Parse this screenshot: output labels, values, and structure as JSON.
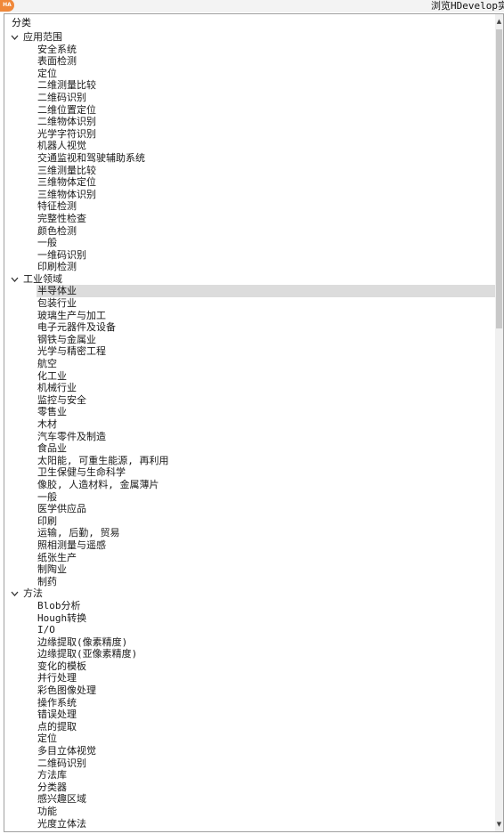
{
  "window": {
    "title": "浏览HDevelop实",
    "icon_text": "HA"
  },
  "tree": {
    "header": "分类",
    "groups": [
      {
        "label": "应用范围",
        "items": [
          "安全系统",
          "表面检测",
          "定位",
          "二维测量比较",
          "二维码识别",
          "二维位置定位",
          "二维物体识别",
          "光学字符识别",
          "机器人视觉",
          "交通监视和驾驶辅助系统",
          "三维测量比较",
          "三维物体定位",
          "三维物体识别",
          "特征检测",
          "完整性检查",
          "颜色检测",
          "一般",
          "一维码识别",
          "印刷检测"
        ]
      },
      {
        "label": "工业领域",
        "items": [
          "半导体业",
          "包装行业",
          "玻璃生产与加工",
          "电子元器件及设备",
          "钢铁与金属业",
          "光学与精密工程",
          "航空",
          "化工业",
          "机械行业",
          "监控与安全",
          "零售业",
          "木材",
          "汽车零件及制造",
          "食品业",
          "太阳能, 可重生能源, 再利用",
          "卫生保健与生命科学",
          "像胶, 人造材料, 金属薄片",
          "一般",
          "医学供应品",
          "印刷",
          "运输, 后勤, 贸易",
          "照相测量与遥感",
          "纸张生产",
          "制陶业",
          "制药"
        ]
      },
      {
        "label": "方法",
        "items": [
          "Blob分析",
          "Hough转换",
          "I/O",
          "边缘提取(像素精度)",
          "边缘提取(亚像素精度)",
          "变化的模板",
          "并行处理",
          "彩色图像处理",
          "操作系统",
          "错误处理",
          "点的提取",
          "定位",
          "多目立体视觉",
          "二维码识别",
          "方法库",
          "分类器",
          "感兴趣区域",
          "功能",
          "光度立体法"
        ]
      }
    ],
    "selected": "半导体业"
  }
}
